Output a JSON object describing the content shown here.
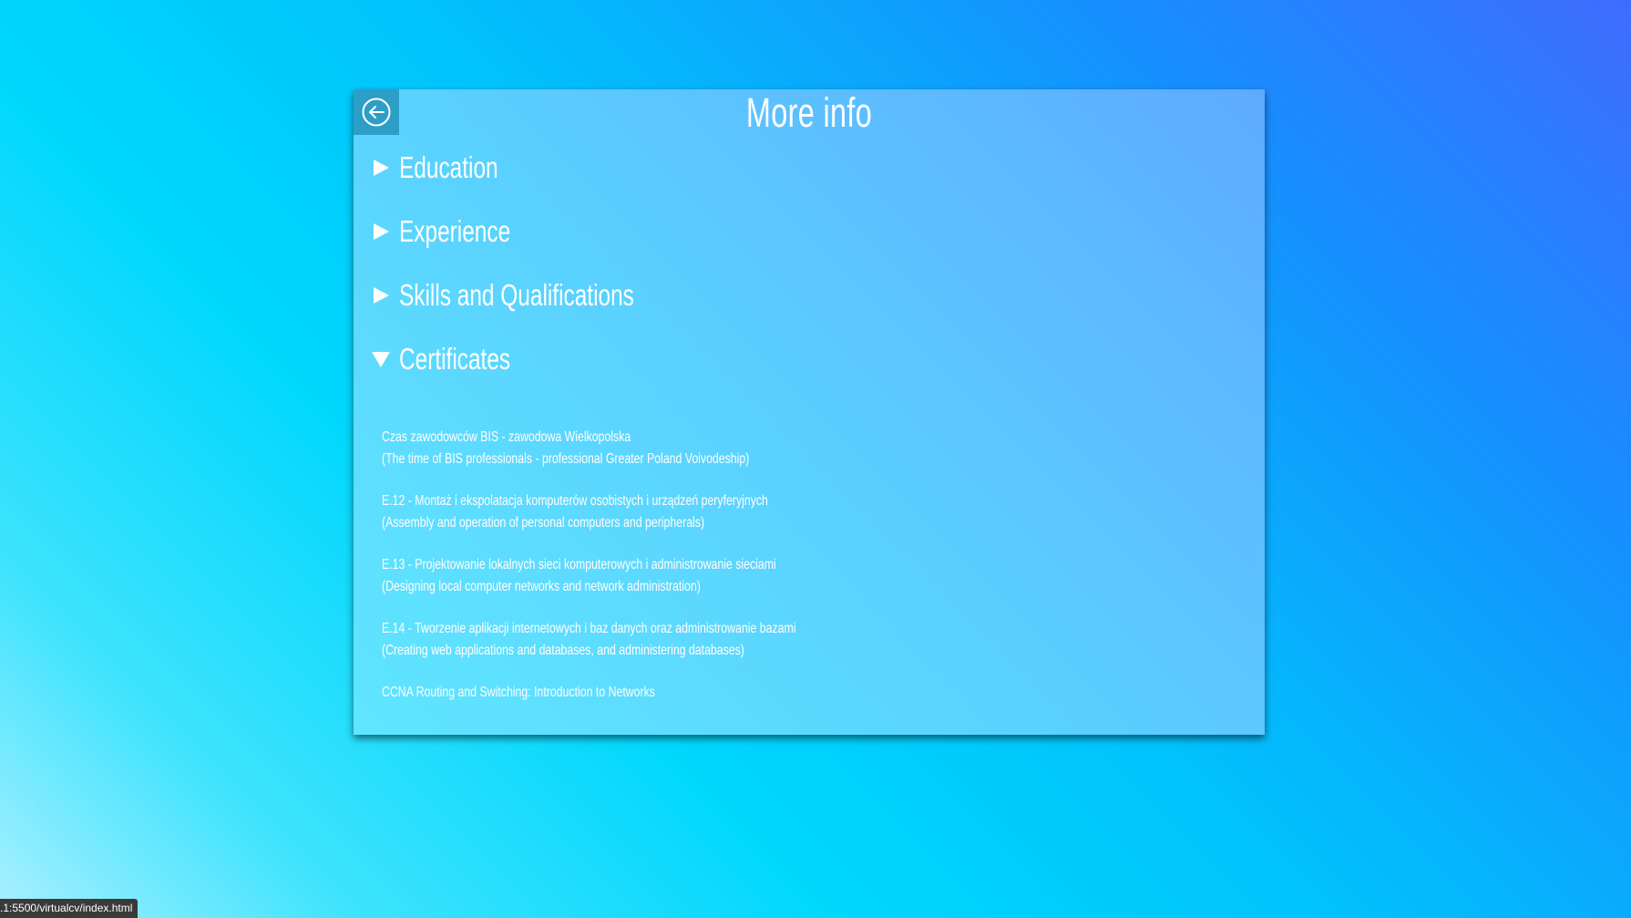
{
  "page": {
    "title": "More info"
  },
  "sections": [
    {
      "label": "Education",
      "expanded": false
    },
    {
      "label": "Experience",
      "expanded": false
    },
    {
      "label": "Skills and Qualifications",
      "expanded": false
    },
    {
      "label": "Certificates",
      "expanded": true
    }
  ],
  "certificates": [
    {
      "line1": "Czas zawodowców BIS - zawodowa Wielkopolska",
      "line2": "(The time of BIS professionals - professional Greater Poland Voivodeship)"
    },
    {
      "line1": "E.12 - Montaż i ekspolatacja komputerów osobistych i urządzeń peryferyjnych",
      "line2": "(Assembly and operation of personal computers and peripherals)"
    },
    {
      "line1": "E.13 - Projektowanie lokalnych sieci komputerowych i administrowanie sieciami",
      "line2": "(Designing local computer networks and network administration)"
    },
    {
      "line1": "E.14 - Tworzenie aplikacji internetowych i baz danych oraz administrowanie bazami",
      "line2": "(Creating web applications and databases, and administering databases)"
    },
    {
      "line1": "CCNA Routing and Switching: Introduction to Networks",
      "line2": ""
    }
  ],
  "status_bar": {
    "url": ".1:5500/virtualcv/index.html"
  },
  "icons": {
    "back": "arrow-left-circle-icon",
    "collapsed": "triangle-right-icon",
    "expanded": "triangle-down-icon"
  },
  "colors": {
    "back_button_bg": "#2d9ec6",
    "text": "#ffffff"
  }
}
